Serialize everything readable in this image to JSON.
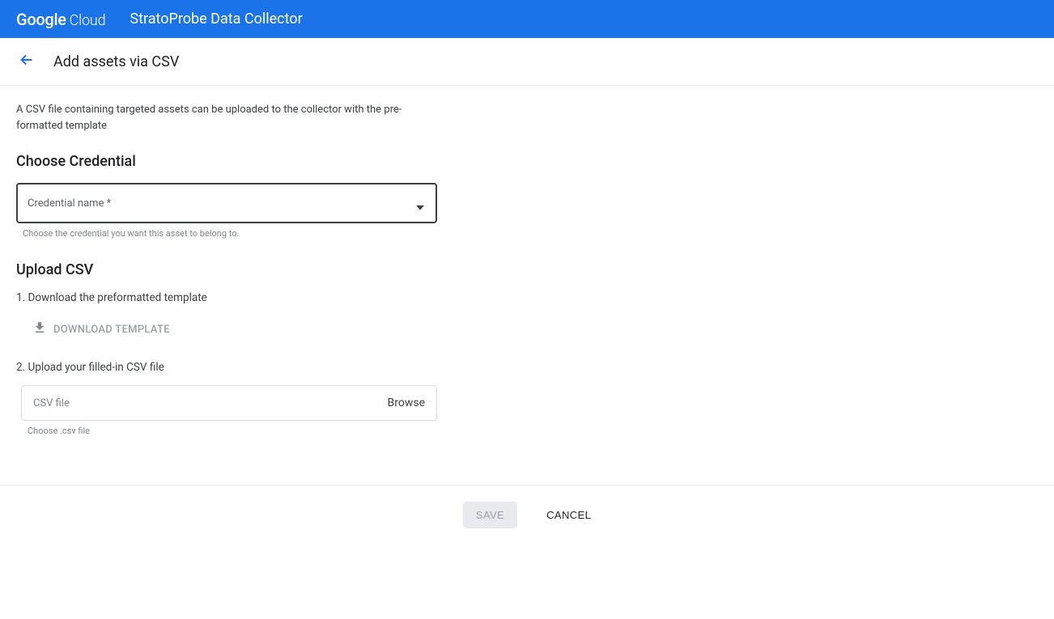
{
  "header": {
    "logo_google": "Google",
    "logo_cloud": "Cloud",
    "app_title": "StratoProbe Data Collector"
  },
  "page": {
    "title": "Add assets via CSV",
    "description": "A CSV file containing targeted assets can be uploaded to the collector with the pre-formatted template"
  },
  "credential": {
    "heading": "Choose Credential",
    "label": "Credential name *",
    "helper": "Choose the credential you want this asset to belong to."
  },
  "upload": {
    "heading": "Upload CSV",
    "step1": "1. Download the preformatted template",
    "download_label": "DOWNLOAD TEMPLATE",
    "step2": "2. Upload your filled-in CSV file",
    "file_placeholder": "CSV file",
    "browse_label": "Browse",
    "file_helper": "Choose .csv file"
  },
  "footer": {
    "save": "SAVE",
    "cancel": "CANCEL"
  }
}
